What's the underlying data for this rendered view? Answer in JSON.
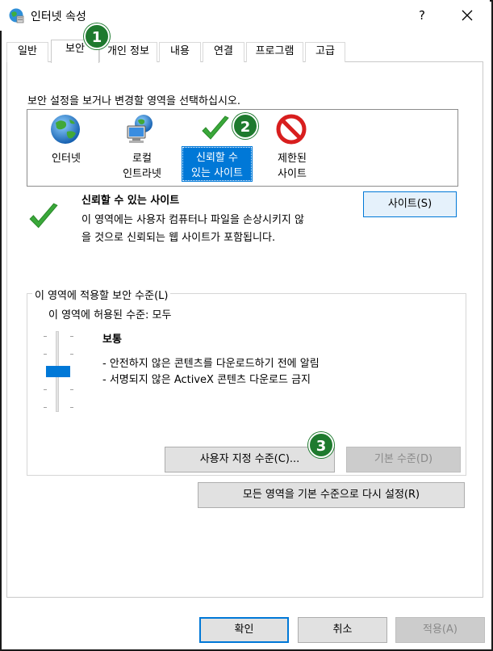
{
  "window": {
    "title": "인터넷 속성",
    "help": "?",
    "close": "✕"
  },
  "tabs": [
    {
      "label": "일반"
    },
    {
      "label": "보안"
    },
    {
      "label": "개인 정보"
    },
    {
      "label": "내용"
    },
    {
      "label": "연결"
    },
    {
      "label": "프로그램"
    },
    {
      "label": "고급"
    }
  ],
  "zones": {
    "prompt": "보안 설정을 보거나 변경할 영역을 선택하십시오.",
    "items": [
      {
        "line1": "인터넷",
        "line2": ""
      },
      {
        "line1": "로컬",
        "line2": "인트라넷"
      },
      {
        "line1": "신뢰할 수",
        "line2": "있는 사이트"
      },
      {
        "line1": "제한된",
        "line2": "사이트"
      }
    ]
  },
  "description": {
    "title": "신뢰할 수 있는 사이트",
    "line1": "이 영역에는 사용자 컴퓨터나 파일을 손상시키지 않",
    "line2": "을 것으로 신뢰되는 웹 사이트가 포함됩니다.",
    "sites_button": "사이트(S)"
  },
  "security_level": {
    "legend": "이 영역에 적용할 보안 수준(L)",
    "allowed": "이 영역에 허용된 수준: 모두",
    "level_name": "보통",
    "bullet1": "- 안전하지 않은 콘텐츠를 다운로드하기 전에 알림",
    "bullet2": "- 서명되지 않은 ActiveX 콘텐츠 다운로드 금지",
    "custom_button": "사용자 지정 수준(C)...",
    "default_button": "기본 수준(D)",
    "reset_button": "모든 영역을 기본 수준으로 다시 설정(R)"
  },
  "footer": {
    "ok": "확인",
    "cancel": "취소",
    "apply": "적용(A)"
  },
  "badges": [
    "1",
    "2",
    "3"
  ],
  "colors": {
    "accent": "#0078d7",
    "badge": "#1e7a2e"
  }
}
